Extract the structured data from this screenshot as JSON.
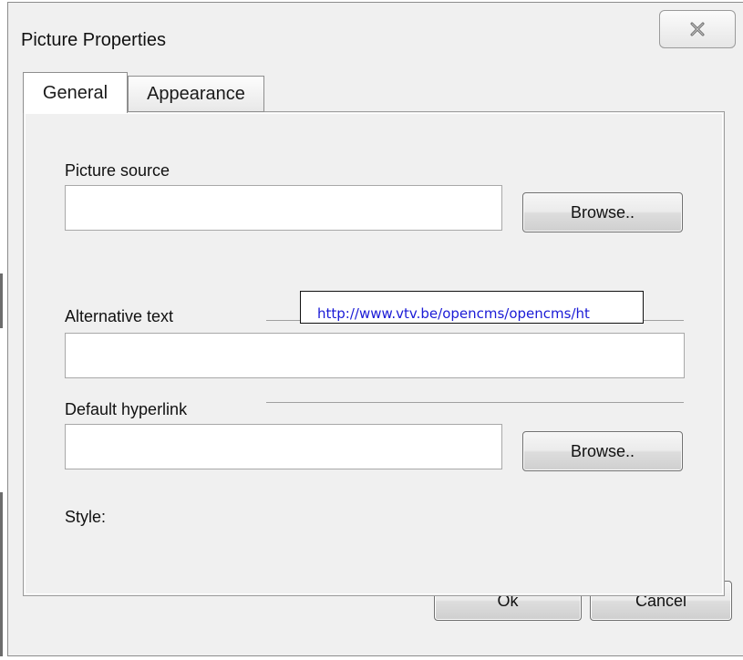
{
  "dialog": {
    "title": "Picture Properties",
    "close_icon": "close-x-icon"
  },
  "tabs": [
    {
      "label": "General",
      "active": true
    },
    {
      "label": "Appearance",
      "active": false
    }
  ],
  "general": {
    "picture_source": {
      "label": "Picture source",
      "value": "",
      "browse_label": "Browse.."
    },
    "alternative_text": {
      "label": "Alternative text",
      "value": ""
    },
    "default_hyperlink": {
      "label": "Default hyperlink",
      "value": "",
      "browse_label": "Browse.."
    },
    "style": {
      "label": "Style:",
      "selected": "",
      "arrow_icon": "dropdown-arrow-icon"
    }
  },
  "tooltip": {
    "text": "http://www.vtv.be/opencms/opencms/ht"
  },
  "footer": {
    "ok_label": "Ok",
    "cancel_label": "Cancel"
  },
  "colors": {
    "dialog_bg": "#f0f0f0",
    "tooltip_link": "#1a1ad6"
  }
}
